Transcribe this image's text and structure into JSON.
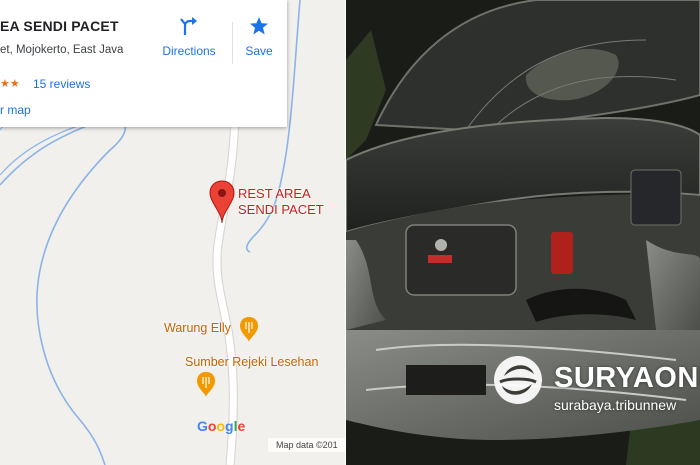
{
  "map": {
    "place_name": "EA SENDI PACET",
    "address": "et, Mojokerto, East Java",
    "stars_glyph": "★★",
    "reviews_label": "15 reviews",
    "map_link": "r map",
    "directions_label": "Directions",
    "save_label": "Save",
    "pin_label_line1": "REST AREA",
    "pin_label_line2": "SENDI PACET",
    "poi_1": "Warung Elly",
    "poi_2": "Sumber Rejeki Lesehan",
    "google_logo": [
      "G",
      "o",
      "o",
      "g",
      "l",
      "e"
    ],
    "map_data": "Map data ©201",
    "colors": {
      "accent": "#1a73e8",
      "pin": "#ea4335",
      "poi": "#c26401",
      "road": "#ffffff",
      "river": "#6fa8dc"
    }
  },
  "photo": {
    "watermark_brand": "SURYAONL",
    "watermark_url": "surabaya.tribunnew",
    "subject": "wrecked car front with crushed hood and exposed engine"
  },
  "icons": [
    "directions-icon",
    "star-icon",
    "map-pin-icon",
    "restaurant-icon",
    "surya-logo-icon"
  ]
}
